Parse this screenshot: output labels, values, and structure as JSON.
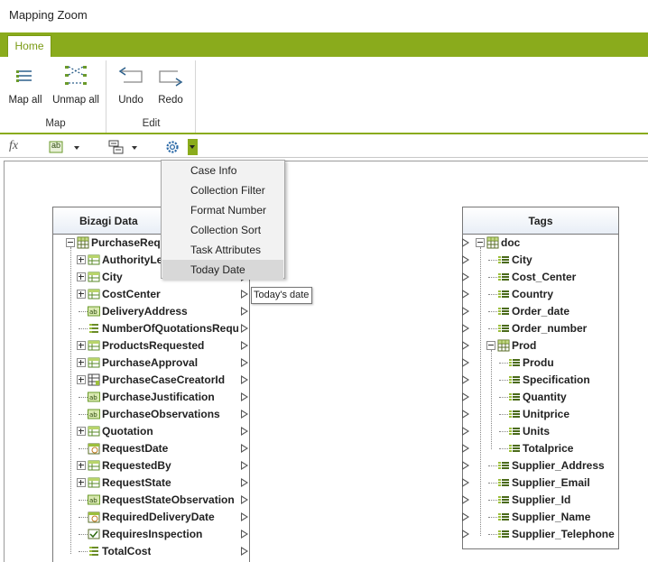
{
  "window": {
    "title": "Mapping Zoom"
  },
  "ribbon": {
    "tab_home": "Home",
    "groups": {
      "map": {
        "label": "Map",
        "map_all": "Map all",
        "unmap_all": "Unmap all"
      },
      "edit": {
        "label": "Edit",
        "undo": "Undo",
        "redo": "Redo"
      }
    }
  },
  "toolbar": {
    "fx_label": "fx",
    "text_tool_label": "ab"
  },
  "menu": {
    "items": [
      "Case Info",
      "Collection Filter",
      "Format Number",
      "Collection Sort",
      "Task Attributes",
      "Today Date"
    ],
    "highlighted": "Today Date"
  },
  "tooltip": "Today's date",
  "bizagi": {
    "title": "Bizagi Data",
    "rows": [
      {
        "label": "PurchaseRequest",
        "icon": "table-icon",
        "expander": "minus",
        "depth": 0
      },
      {
        "label": "AuthorityLevel",
        "icon": "collection-icon",
        "expander": "plus",
        "depth": 1
      },
      {
        "label": "City",
        "icon": "collection-icon",
        "expander": "plus",
        "depth": 1
      },
      {
        "label": "CostCenter",
        "icon": "collection-icon",
        "expander": "plus",
        "depth": 1
      },
      {
        "label": "DeliveryAddress",
        "icon": "text-icon",
        "expander": "",
        "depth": 1
      },
      {
        "label": "NumberOfQuotationsRequired",
        "icon": "number-icon",
        "expander": "",
        "depth": 1
      },
      {
        "label": "ProductsRequested",
        "icon": "collection-icon",
        "expander": "plus",
        "depth": 1
      },
      {
        "label": "PurchaseApproval",
        "icon": "collection-icon",
        "expander": "plus",
        "depth": 1
      },
      {
        "label": "PurchaseCaseCreatorId",
        "icon": "entity-icon",
        "expander": "plus",
        "depth": 1
      },
      {
        "label": "PurchaseJustification",
        "icon": "text-icon",
        "expander": "",
        "depth": 1
      },
      {
        "label": "PurchaseObservations",
        "icon": "text-icon",
        "expander": "",
        "depth": 1
      },
      {
        "label": "Quotation",
        "icon": "collection-icon",
        "expander": "plus",
        "depth": 1
      },
      {
        "label": "RequestDate",
        "icon": "date-icon",
        "expander": "",
        "depth": 1
      },
      {
        "label": "RequestedBy",
        "icon": "collection-icon",
        "expander": "plus",
        "depth": 1
      },
      {
        "label": "RequestState",
        "icon": "collection-icon",
        "expander": "plus",
        "depth": 1
      },
      {
        "label": "RequestStateObservation",
        "icon": "text-icon",
        "expander": "",
        "depth": 1
      },
      {
        "label": "RequiredDeliveryDate",
        "icon": "date-icon",
        "expander": "",
        "depth": 1
      },
      {
        "label": "RequiresInspection",
        "icon": "checkbox-icon",
        "expander": "",
        "depth": 1
      },
      {
        "label": "TotalCost",
        "icon": "number-icon",
        "expander": "",
        "depth": 1
      }
    ]
  },
  "tags": {
    "title": "Tags",
    "rows": [
      {
        "label": "doc",
        "icon": "table-icon",
        "expander": "minus",
        "depth": 0
      },
      {
        "label": "City",
        "icon": "element-icon",
        "expander": "",
        "depth": 1
      },
      {
        "label": "Cost_Center",
        "icon": "element-icon",
        "expander": "",
        "depth": 1
      },
      {
        "label": "Country",
        "icon": "element-icon",
        "expander": "",
        "depth": 1
      },
      {
        "label": "Order_date",
        "icon": "element-icon",
        "expander": "",
        "depth": 1
      },
      {
        "label": "Order_number",
        "icon": "element-icon",
        "expander": "",
        "depth": 1
      },
      {
        "label": "Prod",
        "icon": "table-icon",
        "expander": "minus",
        "depth": 1
      },
      {
        "label": "Produ",
        "icon": "element-icon",
        "expander": "",
        "depth": 2
      },
      {
        "label": "Specification",
        "icon": "element-icon",
        "expander": "",
        "depth": 2
      },
      {
        "label": "Quantity",
        "icon": "element-icon",
        "expander": "",
        "depth": 2
      },
      {
        "label": "Unitprice",
        "icon": "element-icon",
        "expander": "",
        "depth": 2
      },
      {
        "label": "Units",
        "icon": "element-icon",
        "expander": "",
        "depth": 2
      },
      {
        "label": "Totalprice",
        "icon": "element-icon",
        "expander": "",
        "depth": 2
      },
      {
        "label": "Supplier_Address",
        "icon": "element-icon",
        "expander": "",
        "depth": 1
      },
      {
        "label": "Supplier_Email",
        "icon": "element-icon",
        "expander": "",
        "depth": 1
      },
      {
        "label": "Supplier_Id",
        "icon": "element-icon",
        "expander": "",
        "depth": 1
      },
      {
        "label": "Supplier_Name",
        "icon": "element-icon",
        "expander": "",
        "depth": 1
      },
      {
        "label": "Supplier_Telephone",
        "icon": "element-icon",
        "expander": "",
        "depth": 1
      }
    ]
  },
  "colors": {
    "accent": "#8aab1c",
    "menu_highlight": "#d8d8d8"
  }
}
